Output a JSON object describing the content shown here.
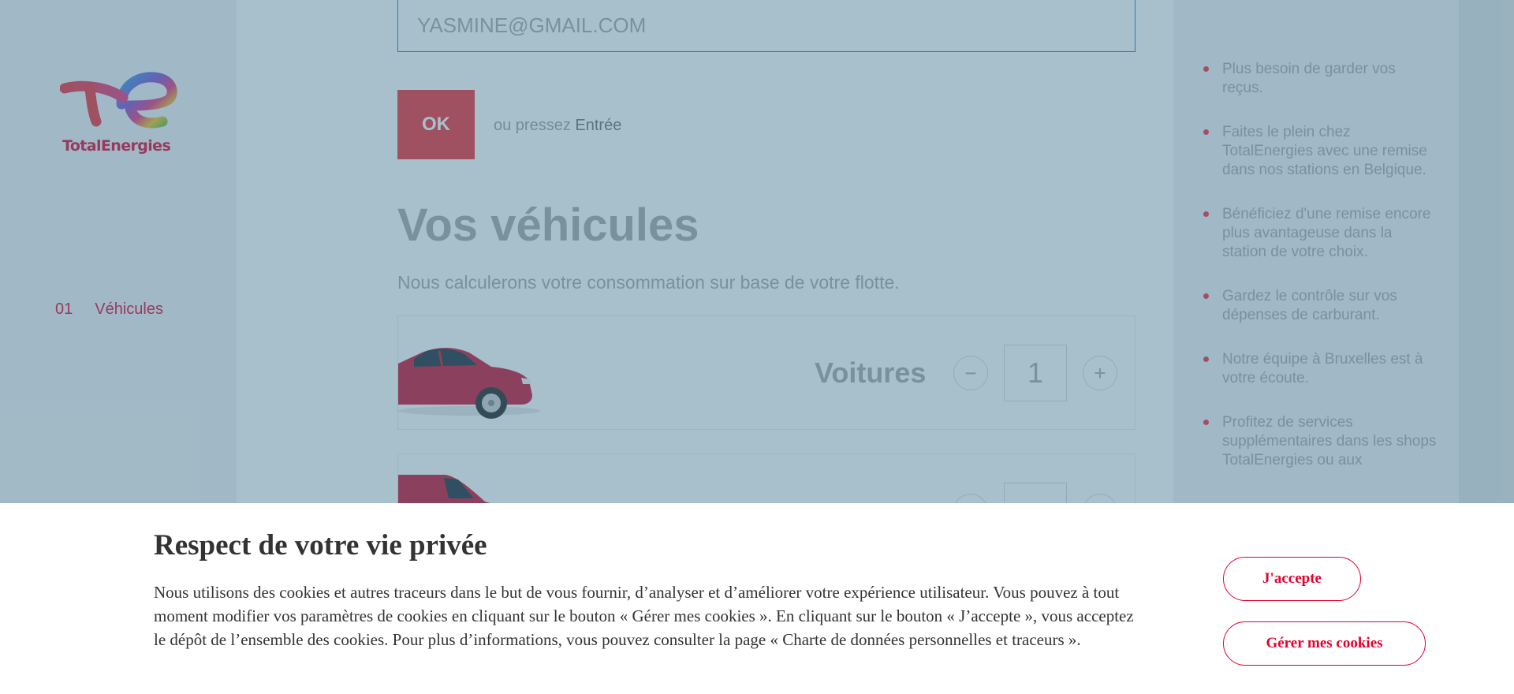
{
  "brand": {
    "logo_text": "TotalEnergies",
    "accent_color": "#e2002e"
  },
  "nav": {
    "steps": [
      {
        "number": "01",
        "label": "Véhicules"
      }
    ]
  },
  "form": {
    "email_value": "YASMINE@GMAIL.COM",
    "ok_label": "OK",
    "hint_prefix": "ou pressez",
    "hint_key": "Entrée"
  },
  "vehicles": {
    "title": "Vos véhicules",
    "subtitle": "Nous calculerons votre consommation sur base de votre flotte.",
    "items": [
      {
        "label": "Voitures",
        "count": "1",
        "icon": "car-icon"
      },
      {
        "label": "",
        "count": "",
        "icon": "van-icon"
      }
    ],
    "minus_glyph": "−",
    "plus_glyph": "+"
  },
  "benefits": [
    "Plus besoin de garder vos reçus.",
    "Faites le plein chez TotalEnergies avec une remise dans nos stations en Belgique.",
    "Bénéficiez d'une remise encore plus avantageuse dans la station de votre choix.",
    "Gardez le contrôle sur vos dépenses de carburant.",
    "Notre équipe à Bruxelles est à votre écoute.",
    "Profitez de services supplémentaires dans les shops TotalEnergies ou aux"
  ],
  "cookie": {
    "title": "Respect de votre vie privée",
    "text": "Nous utilisons des cookies et autres traceurs dans le but de vous fournir, d’analyser et d’améliorer votre expérience utilisateur. Vous pouvez à tout moment modifier vos paramètres de cookies en cliquant sur le bouton « Gérer mes cookies ». En cliquant sur le bouton « J’accepte », vous acceptez le dépôt de l’ensemble des cookies. Pour plus d’informations, vous pouvez consulter la page « Charte de données personnelles et traceurs ».",
    "accept_label": "J'accepte",
    "manage_label": "Gérer mes cookies"
  }
}
